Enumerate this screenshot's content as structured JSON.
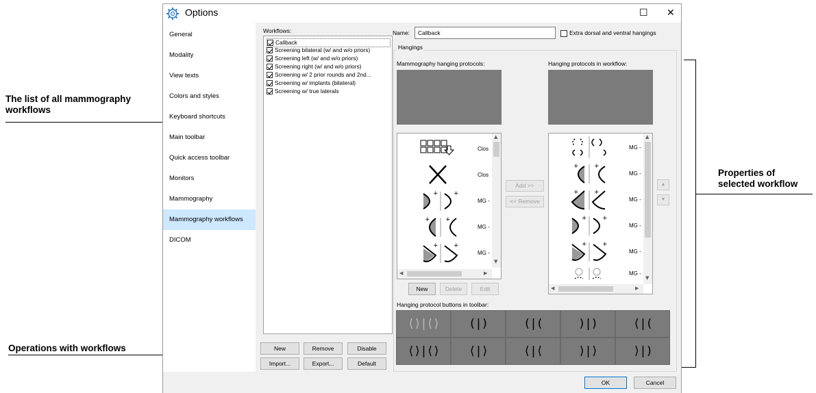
{
  "annotations": {
    "workflows_list": "The list of all mammography workflows",
    "operations": "Operations with workflows",
    "properties": "Properties of selected workflow"
  },
  "window": {
    "title": "Options",
    "maximize_glyph": "☐",
    "close_glyph": "✕"
  },
  "sidebar": {
    "items": [
      {
        "label": "General"
      },
      {
        "label": "Modality"
      },
      {
        "label": "View texts"
      },
      {
        "label": "Colors and styles"
      },
      {
        "label": "Keyboard shortcuts"
      },
      {
        "label": "Main toolbar"
      },
      {
        "label": "Quick access toolbar"
      },
      {
        "label": "Monitors"
      },
      {
        "label": "Mammography"
      },
      {
        "label": "Mammography workflows"
      },
      {
        "label": "DICOM"
      }
    ],
    "selected": "Mammography workflows"
  },
  "workflows": {
    "label": "Workflows:",
    "items": [
      "Callback",
      "Screening bilateral (w/ and w/o priors)",
      "Screening left (w/ and w/o priors)",
      "Screening right (w/ and w/o priors)",
      "Screening w/ 2 prior rounds and 2nd...",
      "Screening w/ implants (bilateral)",
      "Screening w/ true laterals"
    ],
    "buttons": {
      "new": "New",
      "remove": "Remove",
      "disable": "Disable",
      "import": "Import...",
      "export": "Export...",
      "default": "Default"
    }
  },
  "properties": {
    "name_label": "Name:",
    "name_value": "Callback",
    "extra_hangings_label": "Extra dorsal and ventral hangings",
    "hangings_label": "Hangings",
    "mammo_protocols_label": "Mammography hanging protocols:",
    "protocols_in_workflow_label": "Hanging protocols in workflow:",
    "left_list": [
      {
        "icon": "grid-down-icon",
        "text": "Clos"
      },
      {
        "icon": "x-icon",
        "text": "Clos"
      },
      {
        "icon": "breast-cc-icon",
        "text": "MG -"
      },
      {
        "icon": "breast-mlo-icon",
        "text": "MG -"
      },
      {
        "icon": "breast-ml-icon",
        "text": "MG -"
      }
    ],
    "right_list": [
      {
        "icon": "implant-icon",
        "text": "MG -"
      },
      {
        "icon": "breast-mlo-icon",
        "text": "MG -"
      },
      {
        "icon": "breast-lm-icon",
        "text": "MG -"
      },
      {
        "icon": "breast-cc-icon",
        "text": "MG -"
      },
      {
        "icon": "breast-ml-icon",
        "text": "MG -"
      },
      {
        "icon": "implant-small-icon",
        "text": "MG -"
      }
    ],
    "add_button": "Add >>",
    "remove_button": "<< Remove",
    "new_button": "New",
    "delete_button": "Delete",
    "edit_button": "Edit",
    "toolbar_buttons_label": "Hanging protocol buttons in toolbar:",
    "toolbar_buttons": [
      "⟨⟩|⟨⟩",
      "(|)",
      "(|(",
      ")|)",
      "⟨|(",
      "⟨⟩|⟨⟩",
      "⟨|⟩",
      "⟨|⟨",
      "⟩|⟩",
      "⟩|)"
    ]
  },
  "footer": {
    "ok": "OK",
    "cancel": "Cancel"
  }
}
